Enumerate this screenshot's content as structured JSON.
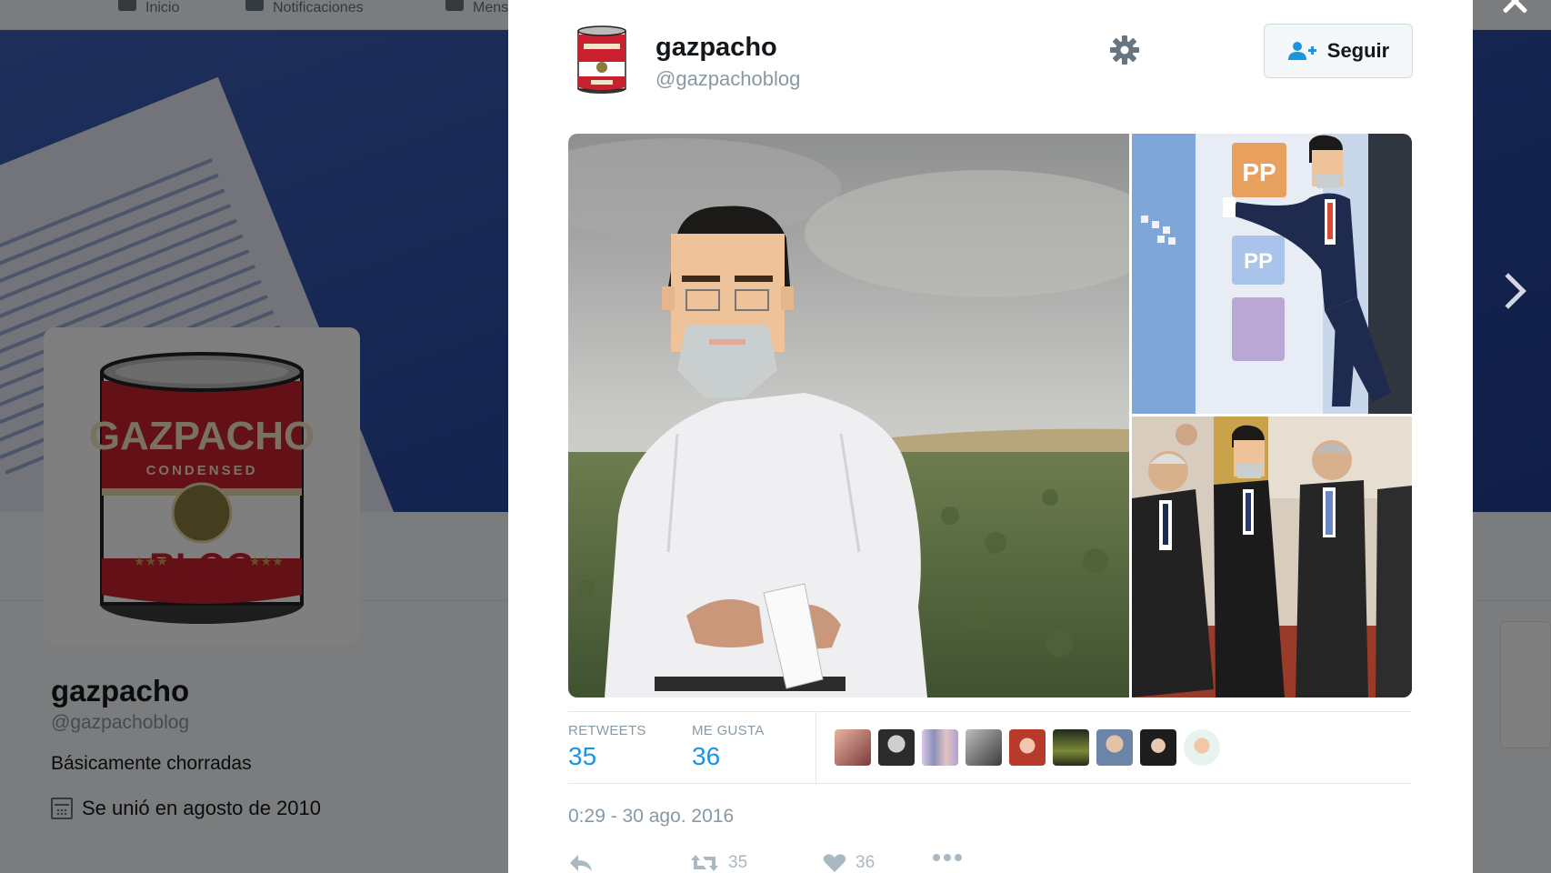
{
  "background_page": {
    "nav": {
      "items": [
        {
          "label": "Inicio",
          "icon": "home-icon"
        },
        {
          "label": "Notificaciones",
          "icon": "bell-icon"
        },
        {
          "label": "Mensajes",
          "icon": "message-icon"
        }
      ]
    },
    "profile": {
      "name": "gazpacho",
      "handle": "@gazpachoblog",
      "bio": "Básicamente chorradas",
      "joined": "Se unió en agosto de 2010",
      "joined_icon": "calendar-icon"
    }
  },
  "tweet": {
    "author": {
      "name": "gazpacho",
      "handle": "@gazpachoblog",
      "avatar_icon": "gazpacho-can-avatar"
    },
    "follow_label": "Seguir",
    "settings_icon": "gear-icon",
    "photos": [
      {
        "name": "photo-field"
      },
      {
        "name": "photo-pp-door"
      },
      {
        "name": "photo-group-suits"
      }
    ],
    "stats": {
      "retweets_label": "RETWEETS",
      "retweets_value": "35",
      "likes_label": "ME GUSTA",
      "likes_value": "36"
    },
    "liker_count_shown": 9,
    "timestamp": "0:29 - 30 ago. 2016",
    "actions": {
      "reply_icon": "reply-icon",
      "retweet_icon": "retweet-icon",
      "retweet_count": "35",
      "like_icon": "heart-icon",
      "like_count": "36",
      "more_icon": "more-icon"
    }
  },
  "colors": {
    "accent": "#1b95e0",
    "muted": "#8899a6",
    "can_red": "#c8202f"
  }
}
